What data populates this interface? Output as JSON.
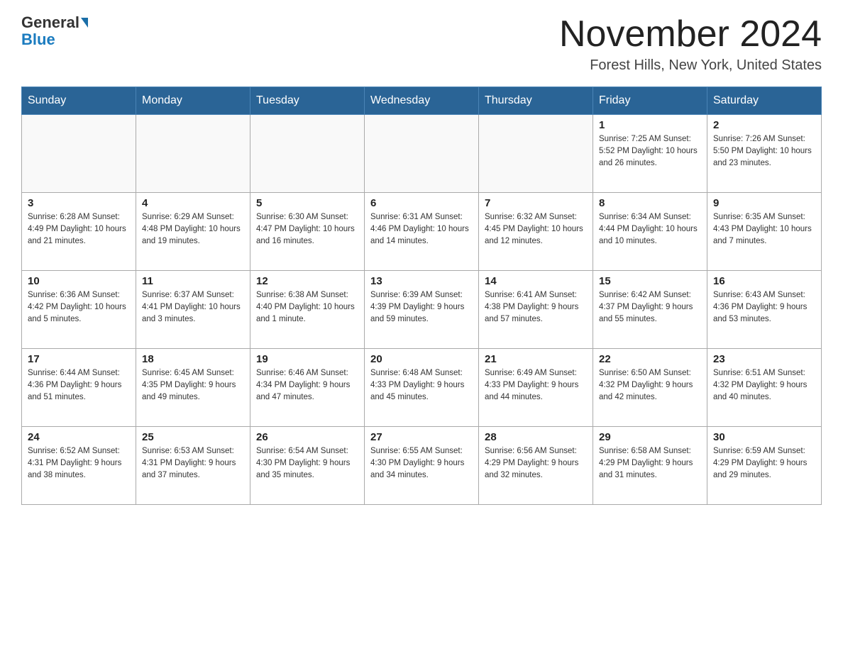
{
  "logo": {
    "general": "General",
    "blue": "Blue"
  },
  "title": "November 2024",
  "subtitle": "Forest Hills, New York, United States",
  "weekdays": [
    "Sunday",
    "Monday",
    "Tuesday",
    "Wednesday",
    "Thursday",
    "Friday",
    "Saturday"
  ],
  "weeks": [
    [
      {
        "day": "",
        "info": ""
      },
      {
        "day": "",
        "info": ""
      },
      {
        "day": "",
        "info": ""
      },
      {
        "day": "",
        "info": ""
      },
      {
        "day": "",
        "info": ""
      },
      {
        "day": "1",
        "info": "Sunrise: 7:25 AM\nSunset: 5:52 PM\nDaylight: 10 hours and 26 minutes."
      },
      {
        "day": "2",
        "info": "Sunrise: 7:26 AM\nSunset: 5:50 PM\nDaylight: 10 hours and 23 minutes."
      }
    ],
    [
      {
        "day": "3",
        "info": "Sunrise: 6:28 AM\nSunset: 4:49 PM\nDaylight: 10 hours and 21 minutes."
      },
      {
        "day": "4",
        "info": "Sunrise: 6:29 AM\nSunset: 4:48 PM\nDaylight: 10 hours and 19 minutes."
      },
      {
        "day": "5",
        "info": "Sunrise: 6:30 AM\nSunset: 4:47 PM\nDaylight: 10 hours and 16 minutes."
      },
      {
        "day": "6",
        "info": "Sunrise: 6:31 AM\nSunset: 4:46 PM\nDaylight: 10 hours and 14 minutes."
      },
      {
        "day": "7",
        "info": "Sunrise: 6:32 AM\nSunset: 4:45 PM\nDaylight: 10 hours and 12 minutes."
      },
      {
        "day": "8",
        "info": "Sunrise: 6:34 AM\nSunset: 4:44 PM\nDaylight: 10 hours and 10 minutes."
      },
      {
        "day": "9",
        "info": "Sunrise: 6:35 AM\nSunset: 4:43 PM\nDaylight: 10 hours and 7 minutes."
      }
    ],
    [
      {
        "day": "10",
        "info": "Sunrise: 6:36 AM\nSunset: 4:42 PM\nDaylight: 10 hours and 5 minutes."
      },
      {
        "day": "11",
        "info": "Sunrise: 6:37 AM\nSunset: 4:41 PM\nDaylight: 10 hours and 3 minutes."
      },
      {
        "day": "12",
        "info": "Sunrise: 6:38 AM\nSunset: 4:40 PM\nDaylight: 10 hours and 1 minute."
      },
      {
        "day": "13",
        "info": "Sunrise: 6:39 AM\nSunset: 4:39 PM\nDaylight: 9 hours and 59 minutes."
      },
      {
        "day": "14",
        "info": "Sunrise: 6:41 AM\nSunset: 4:38 PM\nDaylight: 9 hours and 57 minutes."
      },
      {
        "day": "15",
        "info": "Sunrise: 6:42 AM\nSunset: 4:37 PM\nDaylight: 9 hours and 55 minutes."
      },
      {
        "day": "16",
        "info": "Sunrise: 6:43 AM\nSunset: 4:36 PM\nDaylight: 9 hours and 53 minutes."
      }
    ],
    [
      {
        "day": "17",
        "info": "Sunrise: 6:44 AM\nSunset: 4:36 PM\nDaylight: 9 hours and 51 minutes."
      },
      {
        "day": "18",
        "info": "Sunrise: 6:45 AM\nSunset: 4:35 PM\nDaylight: 9 hours and 49 minutes."
      },
      {
        "day": "19",
        "info": "Sunrise: 6:46 AM\nSunset: 4:34 PM\nDaylight: 9 hours and 47 minutes."
      },
      {
        "day": "20",
        "info": "Sunrise: 6:48 AM\nSunset: 4:33 PM\nDaylight: 9 hours and 45 minutes."
      },
      {
        "day": "21",
        "info": "Sunrise: 6:49 AM\nSunset: 4:33 PM\nDaylight: 9 hours and 44 minutes."
      },
      {
        "day": "22",
        "info": "Sunrise: 6:50 AM\nSunset: 4:32 PM\nDaylight: 9 hours and 42 minutes."
      },
      {
        "day": "23",
        "info": "Sunrise: 6:51 AM\nSunset: 4:32 PM\nDaylight: 9 hours and 40 minutes."
      }
    ],
    [
      {
        "day": "24",
        "info": "Sunrise: 6:52 AM\nSunset: 4:31 PM\nDaylight: 9 hours and 38 minutes."
      },
      {
        "day": "25",
        "info": "Sunrise: 6:53 AM\nSunset: 4:31 PM\nDaylight: 9 hours and 37 minutes."
      },
      {
        "day": "26",
        "info": "Sunrise: 6:54 AM\nSunset: 4:30 PM\nDaylight: 9 hours and 35 minutes."
      },
      {
        "day": "27",
        "info": "Sunrise: 6:55 AM\nSunset: 4:30 PM\nDaylight: 9 hours and 34 minutes."
      },
      {
        "day": "28",
        "info": "Sunrise: 6:56 AM\nSunset: 4:29 PM\nDaylight: 9 hours and 32 minutes."
      },
      {
        "day": "29",
        "info": "Sunrise: 6:58 AM\nSunset: 4:29 PM\nDaylight: 9 hours and 31 minutes."
      },
      {
        "day": "30",
        "info": "Sunrise: 6:59 AM\nSunset: 4:29 PM\nDaylight: 9 hours and 29 minutes."
      }
    ]
  ]
}
